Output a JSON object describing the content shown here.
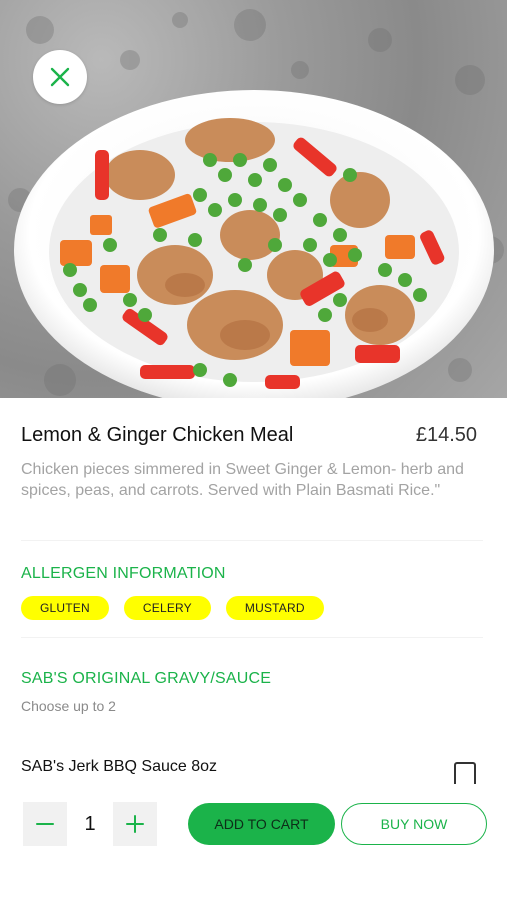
{
  "item": {
    "name": "Lemon & Ginger Chicken Meal",
    "price": "£14.50",
    "description": "Chicken pieces simmered in Sweet Ginger & Lemon- herb and spices, peas, and carrots. Served with Plain Basmati Rice.\""
  },
  "allergens": {
    "title": "ALLERGEN INFORMATION",
    "items": [
      "GLUTEN",
      "CELERY",
      "MUSTARD"
    ]
  },
  "sauce": {
    "title": "SAB'S ORIGINAL GRAVY/SAUCE",
    "subtitle": "Choose up to 2",
    "options": [
      {
        "label": "SAB's Jerk BBQ Sauce 8oz",
        "checked": false
      }
    ]
  },
  "footer": {
    "quantity": "1",
    "add_to_cart_label": "ADD TO CART",
    "buy_now_label": "BUY NOW"
  },
  "colors": {
    "accent": "#1bb34a",
    "chip": "#ffff00"
  },
  "icons": {
    "close": "close-icon",
    "minus": "minus-icon",
    "plus": "plus-icon"
  }
}
